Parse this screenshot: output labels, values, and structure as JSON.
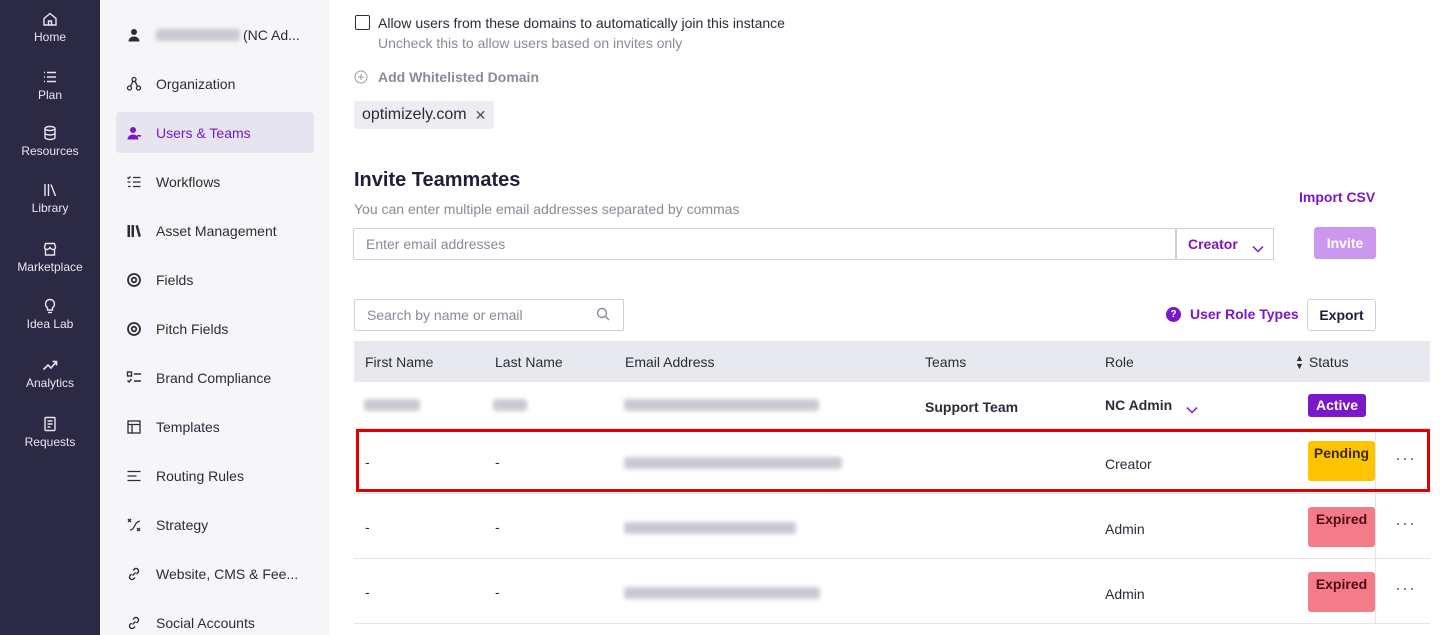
{
  "rail": {
    "items": [
      {
        "label": "Home",
        "icon": "home-icon"
      },
      {
        "label": "Plan",
        "icon": "list-icon"
      },
      {
        "label": "Resources",
        "icon": "database-icon"
      },
      {
        "label": "Library",
        "icon": "library-icon"
      },
      {
        "label": "Marketplace",
        "icon": "store-icon"
      },
      {
        "label": "Idea Lab",
        "icon": "lightbulb-icon"
      },
      {
        "label": "Analytics",
        "icon": "trend-icon"
      },
      {
        "label": "Requests",
        "icon": "document-icon"
      }
    ]
  },
  "sidebar": {
    "user_suffix": "(NC Ad...",
    "items": [
      {
        "label": "Organization",
        "icon": "organization-icon"
      },
      {
        "label": "Users & Teams",
        "icon": "user-icon",
        "active": true
      },
      {
        "label": "Workflows",
        "icon": "workflow-icon"
      },
      {
        "label": "Asset Management",
        "icon": "books-icon"
      },
      {
        "label": "Fields",
        "icon": "target-icon"
      },
      {
        "label": "Pitch Fields",
        "icon": "target-icon"
      },
      {
        "label": "Brand Compliance",
        "icon": "checklist-icon"
      },
      {
        "label": "Templates",
        "icon": "template-icon"
      },
      {
        "label": "Routing Rules",
        "icon": "routing-icon"
      },
      {
        "label": "Strategy",
        "icon": "strategy-icon"
      },
      {
        "label": "Website, CMS & Fee...",
        "icon": "link-icon"
      },
      {
        "label": "Social Accounts",
        "icon": "link-icon"
      }
    ]
  },
  "domains": {
    "allow_label": "Allow users from these domains to automatically join this instance",
    "allow_hint": "Uncheck this to allow users based on invites only",
    "add_label": "Add Whitelisted Domain",
    "chips": [
      "optimizely.com"
    ]
  },
  "invite": {
    "title": "Invite Teammates",
    "subtitle": "You can enter multiple email addresses separated by commas",
    "import_csv": "Import CSV",
    "email_placeholder": "Enter email addresses",
    "role": "Creator",
    "invite_button": "Invite"
  },
  "users": {
    "search_placeholder": "Search by name or email",
    "role_types_link": "User Role Types",
    "export_button": "Export",
    "columns": [
      "First Name",
      "Last Name",
      "Email Address",
      "Teams",
      "Role",
      "Status"
    ],
    "rows": [
      {
        "first": "",
        "last": "",
        "email": "",
        "team": "Support Team",
        "role": "NC Admin",
        "role_dropdown": true,
        "status": "Active",
        "status_color": "#7a17c9"
      },
      {
        "first": "-",
        "last": "-",
        "email": "",
        "team": "",
        "role": "Creator",
        "role_dropdown": false,
        "status": "Pending",
        "status_color": "#ffc400"
      },
      {
        "first": "-",
        "last": "-",
        "email": "",
        "team": "",
        "role": "Admin",
        "role_dropdown": false,
        "status": "Expired",
        "status_color": "#f47c88"
      },
      {
        "first": "-",
        "last": "-",
        "email": "",
        "team": "",
        "role": "Admin",
        "role_dropdown": false,
        "status": "Expired",
        "status_color": "#f47c88"
      }
    ]
  },
  "colors": {
    "accent": "#7a17c9",
    "rail_bg": "#2b2944",
    "highlight": "#e00000"
  }
}
